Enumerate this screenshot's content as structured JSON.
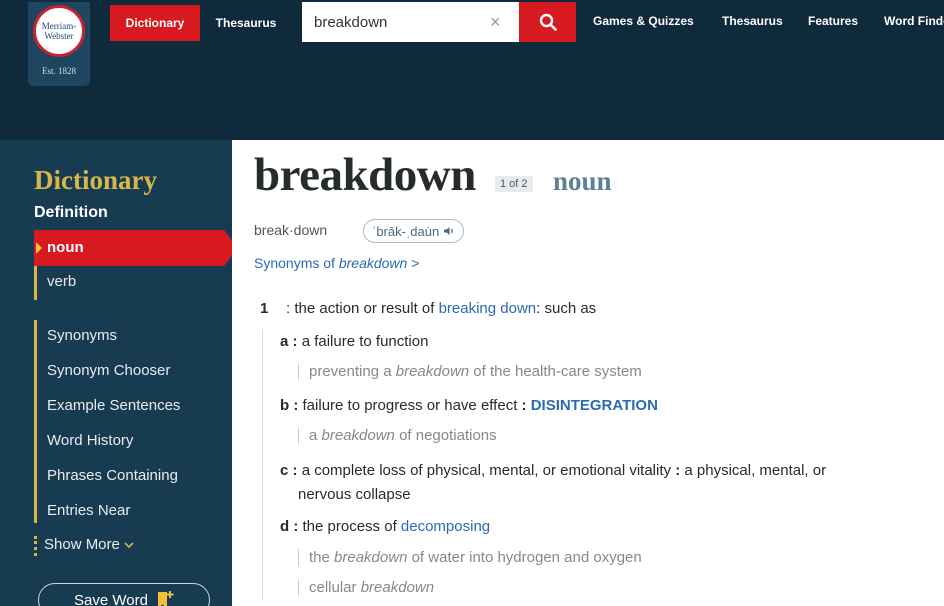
{
  "header": {
    "logo_name": "Merriam-Webster",
    "logo_est": "Est. 1828",
    "tabs": [
      "Dictionary",
      "Thesaurus"
    ],
    "search": {
      "value": "breakdown",
      "clear_glyph": "×"
    },
    "links": [
      "Games & Quizzes",
      "Thesaurus",
      "Features",
      "Word Finder"
    ],
    "colors": {
      "header_bg": "#0f2a3b",
      "brand_red": "#d71920"
    }
  },
  "sidebar": {
    "title": "Dictionary",
    "subtitle": "Definition",
    "pos_items": [
      "noun",
      "verb"
    ],
    "items": [
      "Synonyms",
      "Synonym Chooser",
      "Example Sentences",
      "Word History",
      "Phrases Containing",
      "Entries Near"
    ],
    "show_more": "Show More",
    "save_word": "Save Word",
    "colors": {
      "bg": "#173c52",
      "accent": "#d9b64a"
    }
  },
  "entry": {
    "headword": "breakdown",
    "badge": "1 of 2",
    "pos": "noun",
    "syllables": "break·down",
    "pronunciation": "ˈbrāk-ˌdau̇n",
    "synonyms_link_prefix": "Synonyms of ",
    "synonyms_link_word": "breakdown",
    "synonyms_link_suffix": " >",
    "sense_number": "1",
    "sense_main": {
      "prefix": ": the action or result of ",
      "link": "breaking down",
      "suffix": ": such as"
    },
    "senses": [
      {
        "letter": "a",
        "text": "a failure to function",
        "examples": [
          {
            "before": "preventing a ",
            "em": "breakdown",
            "after": " of the health-care system"
          }
        ]
      },
      {
        "letter": "b",
        "text": "failure to progress or have effect",
        "syn": "DISINTEGRATION",
        "examples": [
          {
            "before": "a ",
            "em": "breakdown",
            "after": " of negotiations"
          }
        ]
      },
      {
        "letter": "c",
        "text": "a complete loss of physical, mental, or emotional vitality",
        "text2": "a physical, mental, or",
        "line2": "nervous collapse"
      },
      {
        "letter": "d",
        "text": "the process of ",
        "link": "decomposing",
        "examples": [
          {
            "before": "the ",
            "em": "breakdown",
            "after": " of water into hydrogen and oxygen"
          },
          {
            "before": "cellular ",
            "em": "breakdown",
            "after": ""
          }
        ]
      }
    ]
  }
}
